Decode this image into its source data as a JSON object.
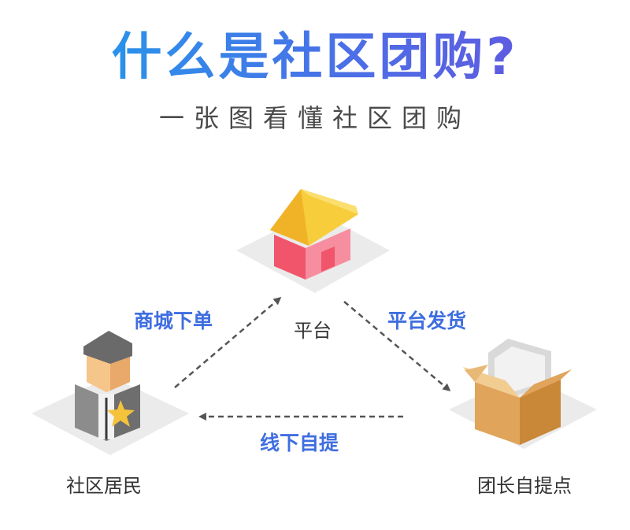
{
  "title": "什么是社区团购?",
  "subtitle": "一张图看懂社区团购",
  "nodes": {
    "platform": "平台",
    "residents": "社区居民",
    "pickup": "团长自提点"
  },
  "edges": {
    "order": "商城下单",
    "ship": "平台发货",
    "pickup": "线下自提"
  },
  "colors": {
    "title_start": "#1aa3ec",
    "title_end": "#6b50de",
    "edge_label": "#3f6ee0",
    "arrow": "#555555"
  },
  "icons": [
    "house-icon",
    "person-icon",
    "box-icon"
  ]
}
